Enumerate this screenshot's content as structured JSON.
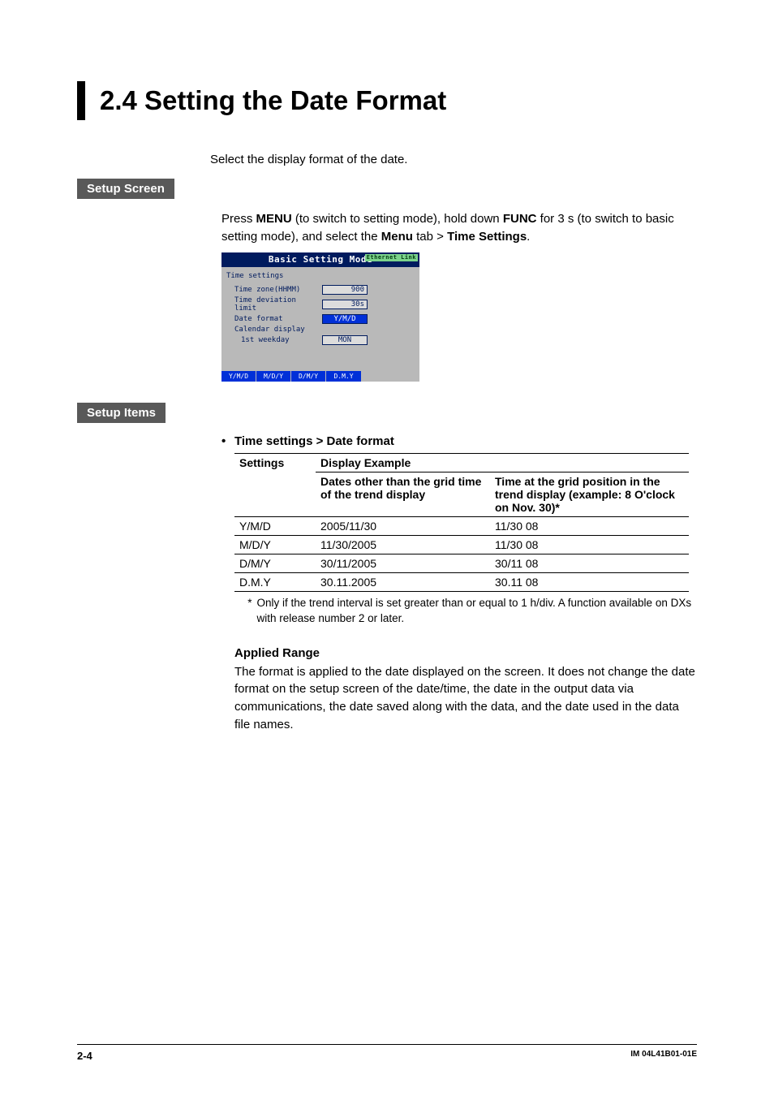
{
  "heading": "2.4    Setting the Date Format",
  "intro": "Select the display format of the date.",
  "labels": {
    "setup_screen": "Setup Screen",
    "setup_items": "Setup Items"
  },
  "setup_text": {
    "p1a": "Press ",
    "menu": "MENU",
    "p1b": " (to switch to setting mode), hold down ",
    "func": "FUNC",
    "p1c": " for 3 s (to switch to basic setting mode), and select the ",
    "menu2": "Menu",
    "p1d": " tab > ",
    "timesettings": "Time Settings",
    "p1e": "."
  },
  "device": {
    "title": "Basic Setting Mode",
    "link": "Ethernet Link",
    "heading": "Time settings",
    "rows": {
      "tz_label": "Time zone(HHMM)",
      "tz_val": "900",
      "dev_label": "Time deviation limit",
      "dev_val": "30s",
      "fmt_label": "Date format",
      "fmt_val": "Y/M/D",
      "cal_label": "Calendar display",
      "wk_label": "1st weekday",
      "wk_val": "MON"
    },
    "softkeys": [
      "Y/M/D",
      "M/D/Y",
      "D/M/Y",
      "D.M.Y"
    ]
  },
  "items": {
    "bullet": "•",
    "bullet_text": "Time settings > Date format",
    "table": {
      "h_settings": "Settings",
      "h_example": "Display Example",
      "h_col1": "Dates other than the grid time of the trend display",
      "h_col2": "Time at the grid position in the trend display (example: 8 O'clock on Nov. 30)*",
      "rows": [
        {
          "s": "Y/M/D",
          "a": "2005/11/30",
          "b": "11/30 08"
        },
        {
          "s": "M/D/Y",
          "a": "11/30/2005",
          "b": "11/30 08"
        },
        {
          "s": "D/M/Y",
          "a": "30/11/2005",
          "b": "30/11 08"
        },
        {
          "s": "D.M.Y",
          "a": "30.11.2005",
          "b": "30.11 08"
        }
      ]
    },
    "footnote_mark": "*",
    "footnote": "Only if the trend interval is set greater than or equal to 1 h/div. A function available on DXs with release number 2 or later.",
    "applied_heading": "Applied Range",
    "applied_text": "The format is applied to the date displayed on the screen. It does not change the date format on the setup screen of the date/time, the date in the output data via communications, the date saved along with the data, and the date used in the data file names."
  },
  "footer": {
    "page": "2-4",
    "doc": "IM 04L41B01-01E"
  }
}
